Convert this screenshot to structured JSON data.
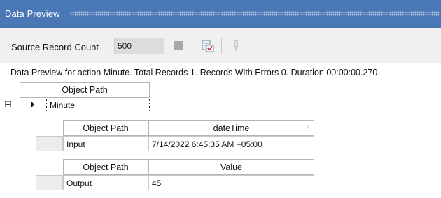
{
  "window": {
    "title": "Data Preview"
  },
  "toolbar": {
    "source_record_count_label": "Source Record Count",
    "source_record_count_value": "500",
    "icons": [
      "stop-icon",
      "preview-check-icon",
      "pin-icon"
    ]
  },
  "status_text": "Data Preview for action Minute. Total Records 1. Records With Errors 0. Duration 00:00:00.270.",
  "grid": {
    "top_header": "Object Path",
    "root_row": {
      "value": "Minute"
    },
    "sub_tables": [
      {
        "headers": [
          "Object Path",
          "dateTime"
        ],
        "row": [
          "Input",
          "7/14/2022 6:45:35 AM +05:00"
        ]
      },
      {
        "headers": [
          "Object Path",
          "Value"
        ],
        "row": [
          "Output",
          "45"
        ]
      }
    ]
  },
  "colors": {
    "titlebar": "#4a78b6",
    "toolbar": "#f0f0f0"
  }
}
